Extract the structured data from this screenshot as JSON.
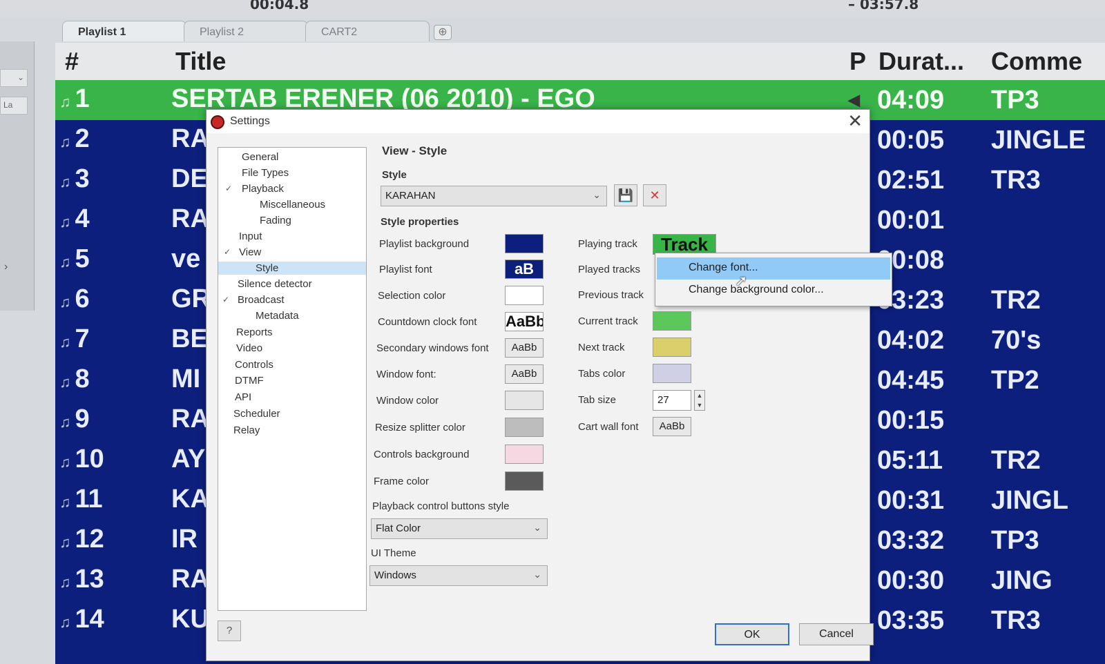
{
  "player": {
    "elapsed": "00:04.8",
    "remaining": "– 03:57.8"
  },
  "tabs": [
    {
      "label": "Playlist 1",
      "active": true
    },
    {
      "label": "Playlist 2",
      "active": false
    },
    {
      "label": "CART2",
      "active": false
    }
  ],
  "left_rail": {
    "label": "La"
  },
  "playlist": {
    "columns": [
      "#",
      "Title",
      "P",
      "Durat...",
      "Comme"
    ],
    "rows": [
      {
        "num": "1",
        "title": "SERTAB ERENER  (06  2010) - EGO",
        "duration": "04:09",
        "comment": "TP3",
        "playing": true
      },
      {
        "num": "2",
        "title": "RA",
        "duration": "00:05",
        "comment": "JINGLE"
      },
      {
        "num": "3",
        "title": "DE",
        "duration": "02:51",
        "comment": "TR3"
      },
      {
        "num": "4",
        "title": "RA",
        "duration": "00:01",
        "comment": ""
      },
      {
        "num": "5",
        "title": "ve",
        "duration": "00:08",
        "comment": ""
      },
      {
        "num": "6",
        "title": "GR",
        "duration": "03:23",
        "comment": "TR2"
      },
      {
        "num": "7",
        "title": "BE",
        "duration": "04:02",
        "comment": "70's"
      },
      {
        "num": "8",
        "title": "MI",
        "duration": "04:45",
        "comment": "TP2"
      },
      {
        "num": "9",
        "title": "RA",
        "duration": "00:15",
        "comment": ""
      },
      {
        "num": "10",
        "title": "AY",
        "duration": "05:11",
        "comment": "TR2"
      },
      {
        "num": "11",
        "title": "KA",
        "duration": "00:31",
        "comment": "JINGL"
      },
      {
        "num": "12",
        "title": "IR",
        "duration": "03:32",
        "comment": "TP3"
      },
      {
        "num": "13",
        "title": "RA",
        "duration": "00:30",
        "comment": "JING"
      },
      {
        "num": "14",
        "title": "KU",
        "duration": "03:35",
        "comment": "TR3"
      }
    ]
  },
  "dialog": {
    "title": "Settings",
    "tree": [
      {
        "label": "General"
      },
      {
        "label": "File Types"
      },
      {
        "label": "Playback",
        "expanded": true
      },
      {
        "label": "Miscellaneous"
      },
      {
        "label": "Fading"
      },
      {
        "label": "Input"
      },
      {
        "label": "View",
        "expanded": true
      },
      {
        "label": "Style",
        "selected": true
      },
      {
        "label": "Silence detector"
      },
      {
        "label": "Broadcast",
        "expanded": true
      },
      {
        "label": "Metadata"
      },
      {
        "label": "Reports"
      },
      {
        "label": "Video"
      },
      {
        "label": "Controls"
      },
      {
        "label": "DTMF"
      },
      {
        "label": "API"
      },
      {
        "label": "Scheduler"
      },
      {
        "label": "Relay"
      }
    ],
    "help_label": "?",
    "page_title": "View - Style",
    "style_label": "Style",
    "style_value": "KARAHAN",
    "properties_label": "Style properties",
    "props_left": [
      {
        "label": "Playlist background",
        "kind": "color",
        "color": "#0d1f7c"
      },
      {
        "label": "Playlist font",
        "kind": "font-dark",
        "sample": "aB"
      },
      {
        "label": "Selection color",
        "kind": "color",
        "color": "#ffffff"
      },
      {
        "label": "Countdown clock font",
        "kind": "font-big",
        "sample": "AaBb"
      },
      {
        "label": "Secondary windows font",
        "kind": "font",
        "sample": "AaBb"
      },
      {
        "label": "Window font:",
        "kind": "font",
        "sample": "AaBb"
      },
      {
        "label": "Window color",
        "kind": "color",
        "color": "#e6e6e6"
      },
      {
        "label": "Resize splitter color",
        "kind": "color",
        "color": "#bdbdbd"
      },
      {
        "label": "Controls background",
        "kind": "color",
        "color": "#f5d8e1"
      },
      {
        "label": "Frame color",
        "kind": "color",
        "color": "#5a5a5a"
      }
    ],
    "props_right": [
      {
        "label": "Playing track",
        "sample": "Track",
        "color": "#39b449"
      },
      {
        "label": "Played tracks"
      },
      {
        "label": "Previous track"
      },
      {
        "label": "Current track",
        "color": "#5cc85c"
      },
      {
        "label": "Next track",
        "color": "#d9cf6b"
      },
      {
        "label": "Tabs color",
        "color": "#cfd0e6"
      },
      {
        "label": "Tab size",
        "value": "27"
      },
      {
        "label": "Cart wall font",
        "sample": "AaBb"
      }
    ],
    "buttons_style_label": "Playback control buttons style",
    "buttons_style_value": "Flat Color",
    "ui_theme_label": "UI Theme",
    "ui_theme_value": "Windows",
    "ok_label": "OK",
    "cancel_label": "Cancel"
  },
  "context_menu": {
    "items": [
      {
        "label": "Change font...",
        "highlighted": true
      },
      {
        "label": "Change background color..."
      }
    ]
  },
  "icons": {
    "note": "music-note-icon",
    "speaker": "speaker-icon",
    "save": "save-icon",
    "delete": "delete-icon",
    "close": "close-icon",
    "chevron": "chevron-down-icon"
  }
}
